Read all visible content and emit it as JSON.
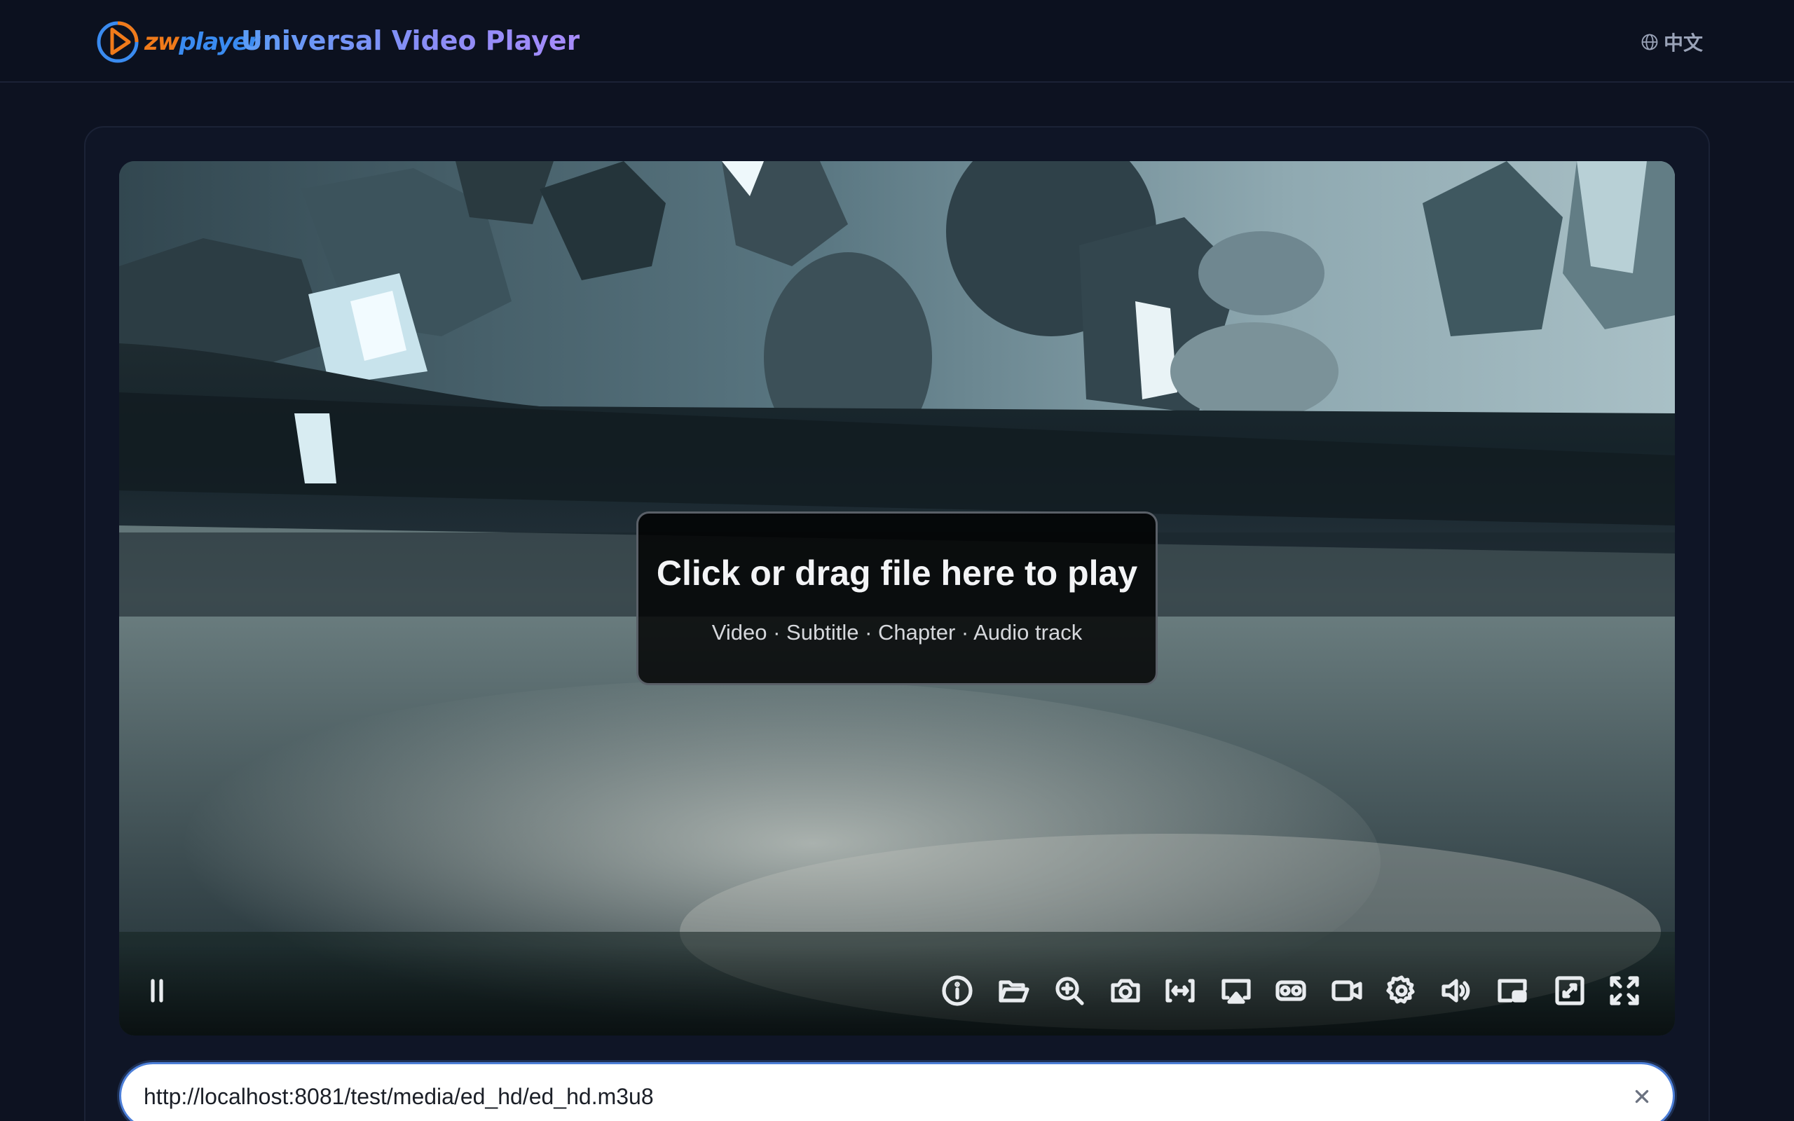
{
  "header": {
    "logo_text_zw": "zw",
    "logo_text_player": "player",
    "app_title": "Universal Video Player",
    "language_toggle": "中文",
    "language_icon": "globe-icon"
  },
  "player": {
    "drop_title": "Click or drag file here to play",
    "drop_subtitle": "Video · Subtitle · Chapter · Audio track",
    "controls": [
      {
        "name": "pause-icon",
        "label": "Pause"
      },
      {
        "name": "info-icon",
        "label": "Info"
      },
      {
        "name": "folder-open-icon",
        "label": "Open file"
      },
      {
        "name": "zoom-in-icon",
        "label": "Zoom"
      },
      {
        "name": "camera-icon",
        "label": "Screenshot"
      },
      {
        "name": "fit-width-icon",
        "label": "Aspect ratio"
      },
      {
        "name": "airplay-icon",
        "label": "AirPlay"
      },
      {
        "name": "vr-icon",
        "label": "VR"
      },
      {
        "name": "video-camera-icon",
        "label": "Record"
      },
      {
        "name": "gear-icon",
        "label": "Settings"
      },
      {
        "name": "volume-icon",
        "label": "Volume"
      },
      {
        "name": "picture-in-picture-icon",
        "label": "Picture in picture"
      },
      {
        "name": "web-fullscreen-icon",
        "label": "Web fullscreen"
      },
      {
        "name": "fullscreen-icon",
        "label": "Fullscreen"
      }
    ]
  },
  "url_bar": {
    "value": "http://localhost:8081/test/media/ed_hd/ed_hd.m3u8",
    "clear_icon": "close-icon"
  },
  "colors": {
    "background": "#0d1221",
    "accent": "#4d7fd8",
    "logo_orange": "#f07a1a",
    "logo_blue": "#3a8bf0",
    "title_gradient_start": "#5b9cf5",
    "title_gradient_end": "#a78bfa"
  }
}
